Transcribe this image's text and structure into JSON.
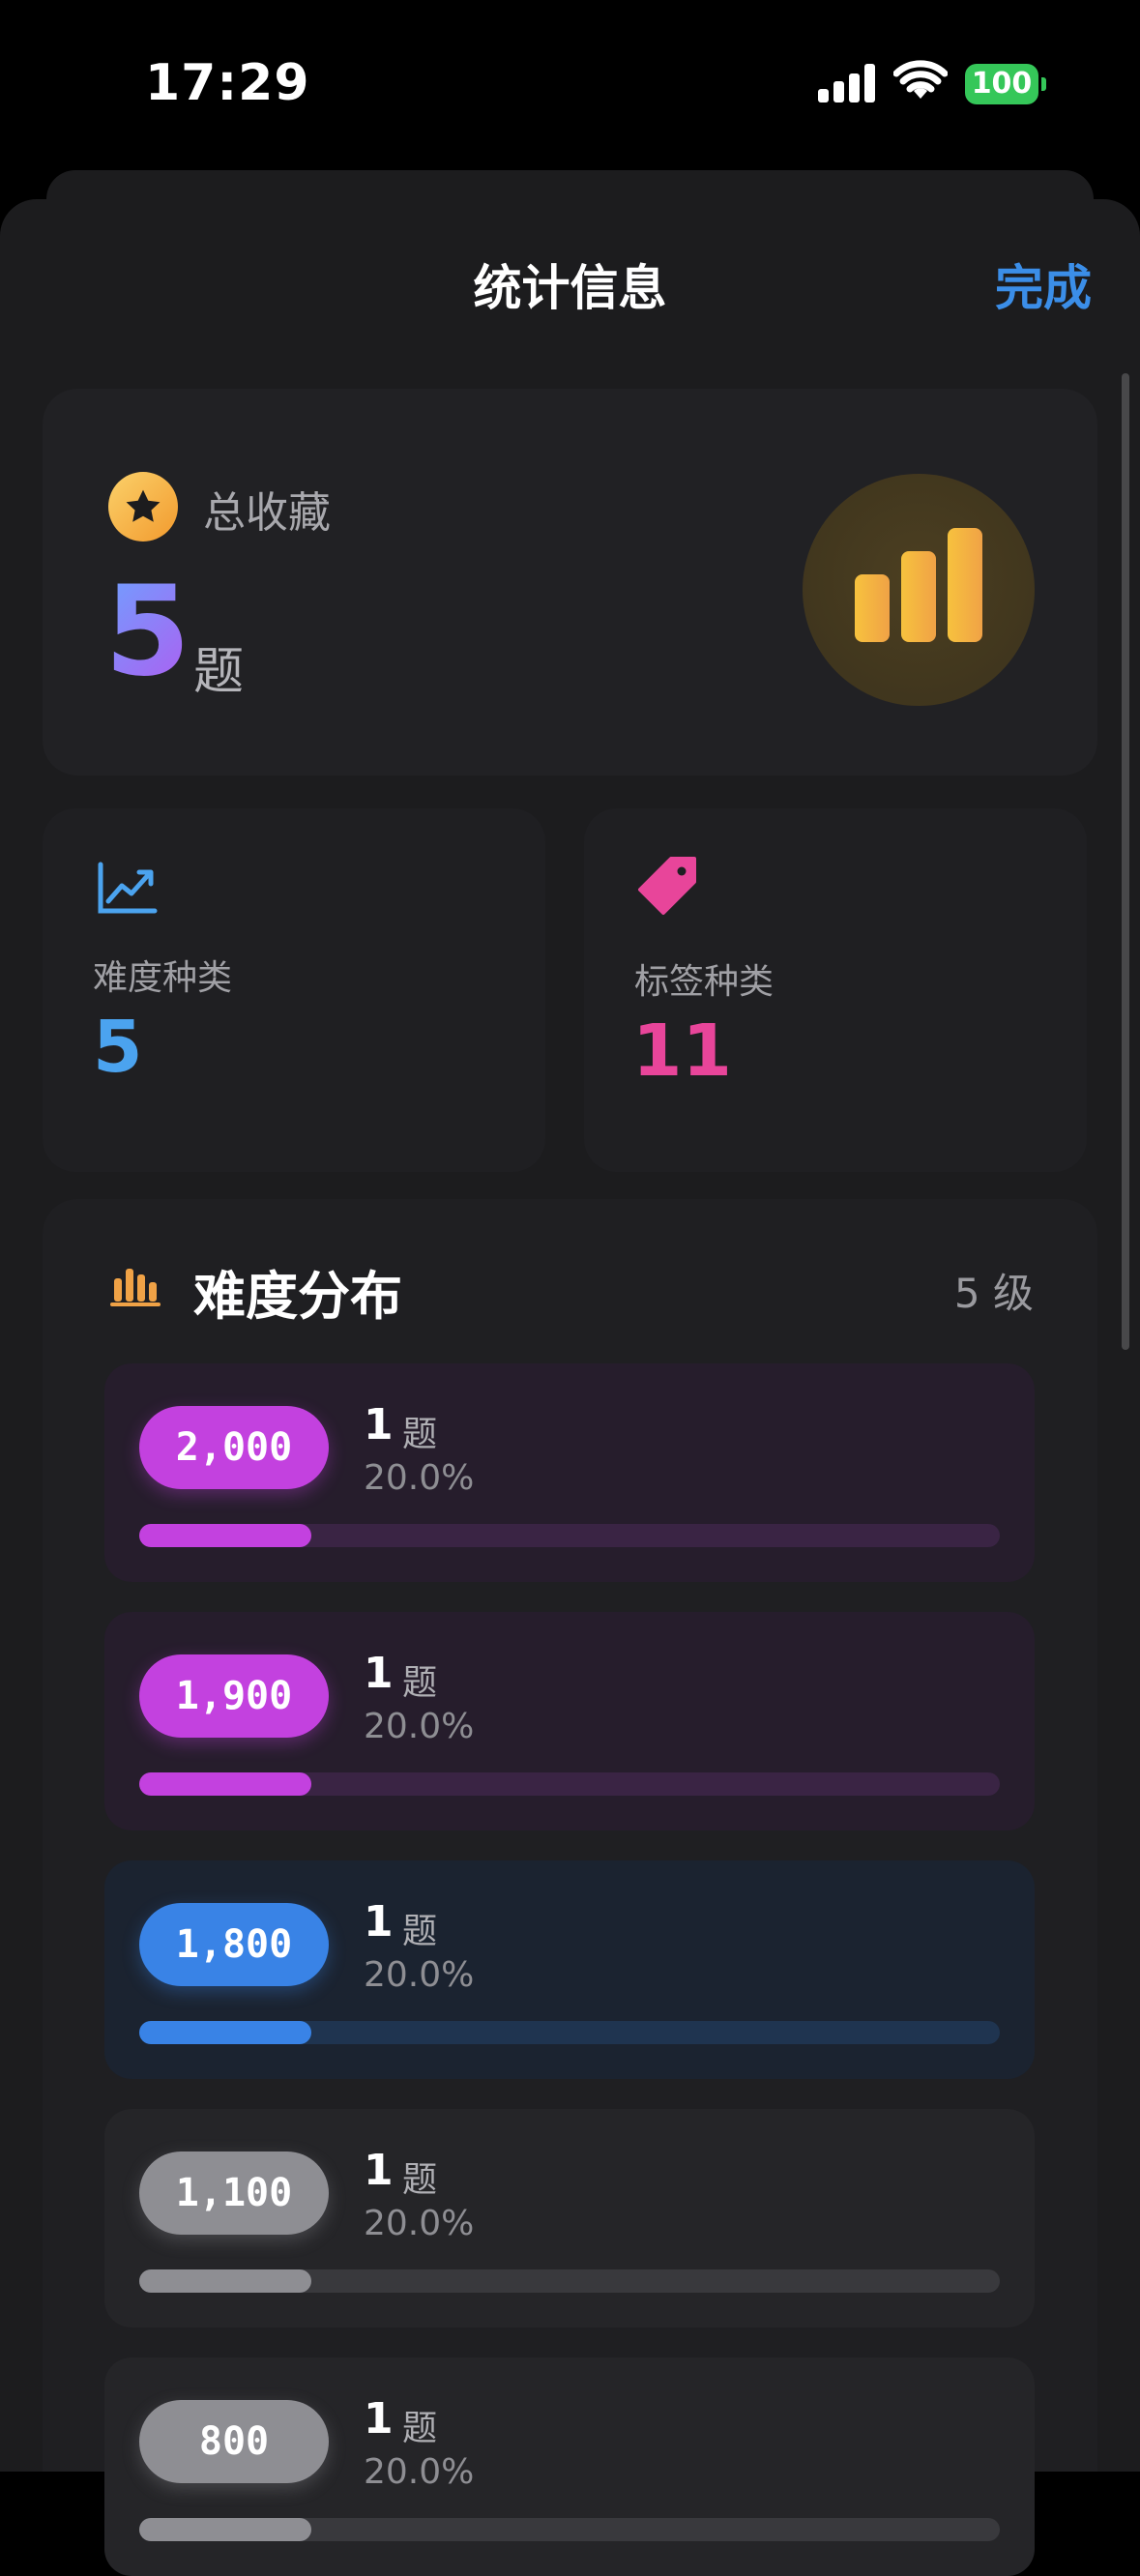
{
  "status_bar": {
    "time": "17:29",
    "battery": "100"
  },
  "nav": {
    "title": "统计信息",
    "done_label": "完成"
  },
  "summary": {
    "label": "总收藏",
    "count": "5",
    "unit": "题"
  },
  "difficulty_types": {
    "label": "难度种类",
    "value": "5"
  },
  "tag_types": {
    "label": "标签种类",
    "value": "11"
  },
  "distribution": {
    "title": "难度分布",
    "level_count": "5 级",
    "rows": [
      {
        "difficulty": "2,000",
        "count": "1",
        "unit": "题",
        "percent": "20.0%",
        "fraction": 0.2,
        "color": "#c341df",
        "bg": "#261d2c",
        "track": "#3a2444"
      },
      {
        "difficulty": "1,900",
        "count": "1",
        "unit": "题",
        "percent": "20.0%",
        "fraction": 0.2,
        "color": "#c341df",
        "bg": "#261d2c",
        "track": "#3a2444"
      },
      {
        "difficulty": "1,800",
        "count": "1",
        "unit": "题",
        "percent": "20.0%",
        "fraction": 0.2,
        "color": "#3983e6",
        "bg": "#1b2330",
        "track": "#1f3450"
      },
      {
        "difficulty": "1,100",
        "count": "1",
        "unit": "题",
        "percent": "20.0%",
        "fraction": 0.2,
        "color": "#8e8e93",
        "bg": "#252528",
        "track": "#39393d"
      },
      {
        "difficulty": "800",
        "count": "1",
        "unit": "题",
        "percent": "20.0%",
        "fraction": 0.2,
        "color": "#8e8e93",
        "bg": "#252528",
        "track": "#39393d"
      }
    ]
  },
  "colors": {
    "accent": "#3b8ee8",
    "difficulty_value": "#4ba3ef",
    "tag_value": "#e8459a",
    "gold": "#f2b33d"
  },
  "icons": [
    "star-icon",
    "bar-chart-icon",
    "trend-chart-icon",
    "tag-icon",
    "distribution-icon",
    "signal-icon",
    "wifi-icon"
  ]
}
